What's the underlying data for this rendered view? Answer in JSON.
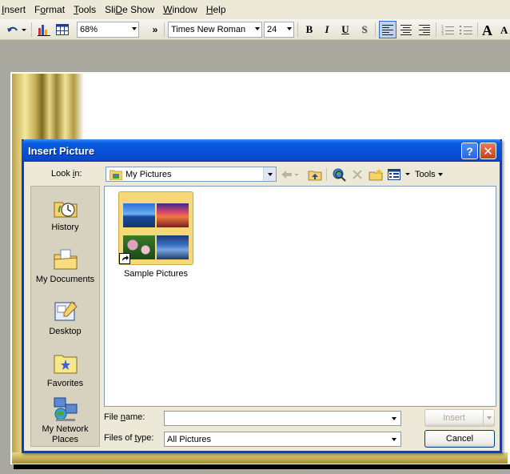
{
  "menubar": {
    "items": [
      {
        "label": "Insert",
        "accel": "I",
        "rest": "nsert"
      },
      {
        "label": "Format",
        "accel": "o",
        "pre": "F",
        "rest": "rmat"
      },
      {
        "label": "Tools",
        "accel": "T",
        "rest": "ools"
      },
      {
        "label": "Slide Show",
        "accel": "D",
        "pre": "Sli",
        "rest": "e Show"
      },
      {
        "label": "Window",
        "accel": "W",
        "rest": "indow"
      },
      {
        "label": "Help",
        "accel": "H",
        "rest": "elp"
      }
    ]
  },
  "toolbar": {
    "zoom": "68%",
    "font": "Times New Roman",
    "font_size": "24",
    "more": "»",
    "bold": "B",
    "italic": "I",
    "underline": "U",
    "shadow": "S"
  },
  "dialog": {
    "title": "Insert Picture",
    "help": "?",
    "close": "✕",
    "look_in_label_pre": "Look ",
    "look_in_label_accel": "i",
    "look_in_label_post": "n:",
    "look_in_value": "My Pictures",
    "tools_label": "Tools",
    "places": [
      {
        "label": "History",
        "icon": "history-icon"
      },
      {
        "label": "My Documents",
        "icon": "my-documents-icon"
      },
      {
        "label": "Desktop",
        "icon": "desktop-icon"
      },
      {
        "label": "Favorites",
        "icon": "favorites-icon"
      },
      {
        "label": "My Network Places",
        "icon": "network-places-icon"
      }
    ],
    "files": [
      {
        "label": "Sample Pictures",
        "icon": "folder-icon"
      }
    ],
    "file_name_label_pre": "File ",
    "file_name_label_accel": "n",
    "file_name_label_post": "ame:",
    "file_name_value": "",
    "files_of_type_label_pre": "Files of ",
    "files_of_type_label_accel": "t",
    "files_of_type_label_post": "ype:",
    "files_of_type_value": "All Pictures",
    "insert_label": "Insert",
    "cancel_label": "Cancel"
  }
}
